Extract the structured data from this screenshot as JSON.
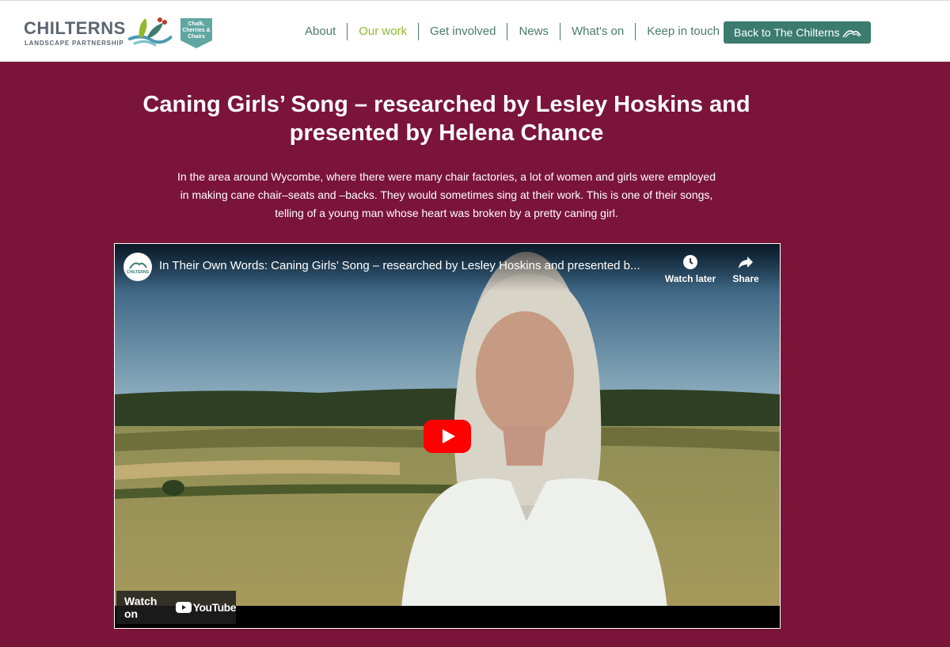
{
  "header": {
    "logo": {
      "wordmark": "CHILTERNS",
      "subtitle": "LANDSCAPE PARTNERSHIP",
      "badge": "Chalk, Cherries & Chairs"
    },
    "nav": [
      {
        "label": "About"
      },
      {
        "label": "Our work"
      },
      {
        "label": "Get involved"
      },
      {
        "label": "News"
      },
      {
        "label": "What's on"
      },
      {
        "label": "Keep in touch"
      }
    ],
    "back_button": "Back to The Chilterns"
  },
  "main": {
    "title": "Caning Girls’ Song – researched by Lesley Hoskins and presented by Helena Chance",
    "description": "In the area around Wycombe, where there were many chair factories, a lot of women and girls were employed in making cane chair–seats and –backs. They would sometimes sing at their work. This is one of their songs, telling of a young man whose heart was broken by a pretty caning girl."
  },
  "video": {
    "channel_avatar_text": "CHILTERNS",
    "title": "In Their Own Words: Caning Girls’ Song – researched by Lesley Hoskins and presented b...",
    "watch_later": "Watch later",
    "share": "Share",
    "watch_on": "Watch on",
    "youtube": "YouTube"
  },
  "colors": {
    "page_background": "#7a1438",
    "nav_text": "#4a7a70",
    "nav_active": "#8dbb2a",
    "button_green": "#3b7c6f",
    "youtube_red": "#ff0000"
  }
}
